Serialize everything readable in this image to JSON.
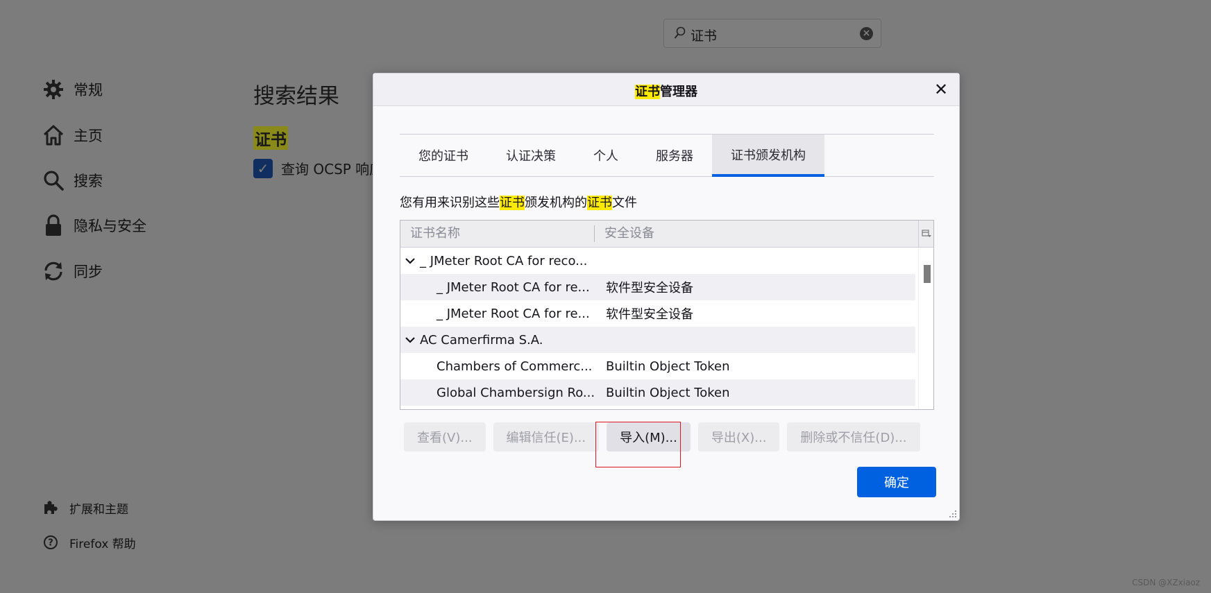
{
  "background": {
    "search": {
      "value": "证书"
    },
    "nav": {
      "general": "常规",
      "home": "主页",
      "search": "搜索",
      "privacy": "隐私与安全",
      "sync": "同步",
      "extensions": "扩展和主题",
      "help": "Firefox 帮助"
    },
    "results_title": "搜索结果",
    "section_highlight": "证书",
    "ocsp_checkbox_label": "查询 OCSP 响应",
    "watermark": "CSDN @XZxiaoz"
  },
  "dialog": {
    "title_highlight": "证书",
    "title_rest": "管理器",
    "close_glyph": "✕",
    "tabs": [
      {
        "label": "您的证书"
      },
      {
        "label": "认证决策"
      },
      {
        "label": "个人"
      },
      {
        "label": "服务器"
      },
      {
        "label": "证书颁发机构",
        "active": true
      }
    ],
    "description": {
      "part1": "您有用来识别这些",
      "hl1": "证书",
      "part2": "颁发机构的",
      "hl2": "证书",
      "part3": "文件"
    },
    "table": {
      "headers": [
        "证书名称",
        "安全设备"
      ],
      "rows": [
        {
          "name": "_ JMeter Root CA for reco...",
          "device": "",
          "parent": true
        },
        {
          "name": "_ JMeter Root CA for re...",
          "device": "软件型安全设备"
        },
        {
          "name": "_ JMeter Root CA for re...",
          "device": "软件型安全设备"
        },
        {
          "name": "AC Camerfirma S.A.",
          "device": "",
          "parent": true
        },
        {
          "name": "Chambers of Commerc...",
          "device": "Builtin Object Token"
        },
        {
          "name": "Global Chambersign Ro...",
          "device": "Builtin Object Token"
        }
      ]
    },
    "buttons": {
      "view": "查看(V)...",
      "edit_trust": "编辑信任(E)...",
      "import": "导入(M)...",
      "export": "导出(X)...",
      "delete": "删除或不信任(D)..."
    },
    "ok": "确定"
  },
  "colors": {
    "accent": "#0061e0",
    "highlight": "#ffea00",
    "annotation": "#e0141e"
  }
}
